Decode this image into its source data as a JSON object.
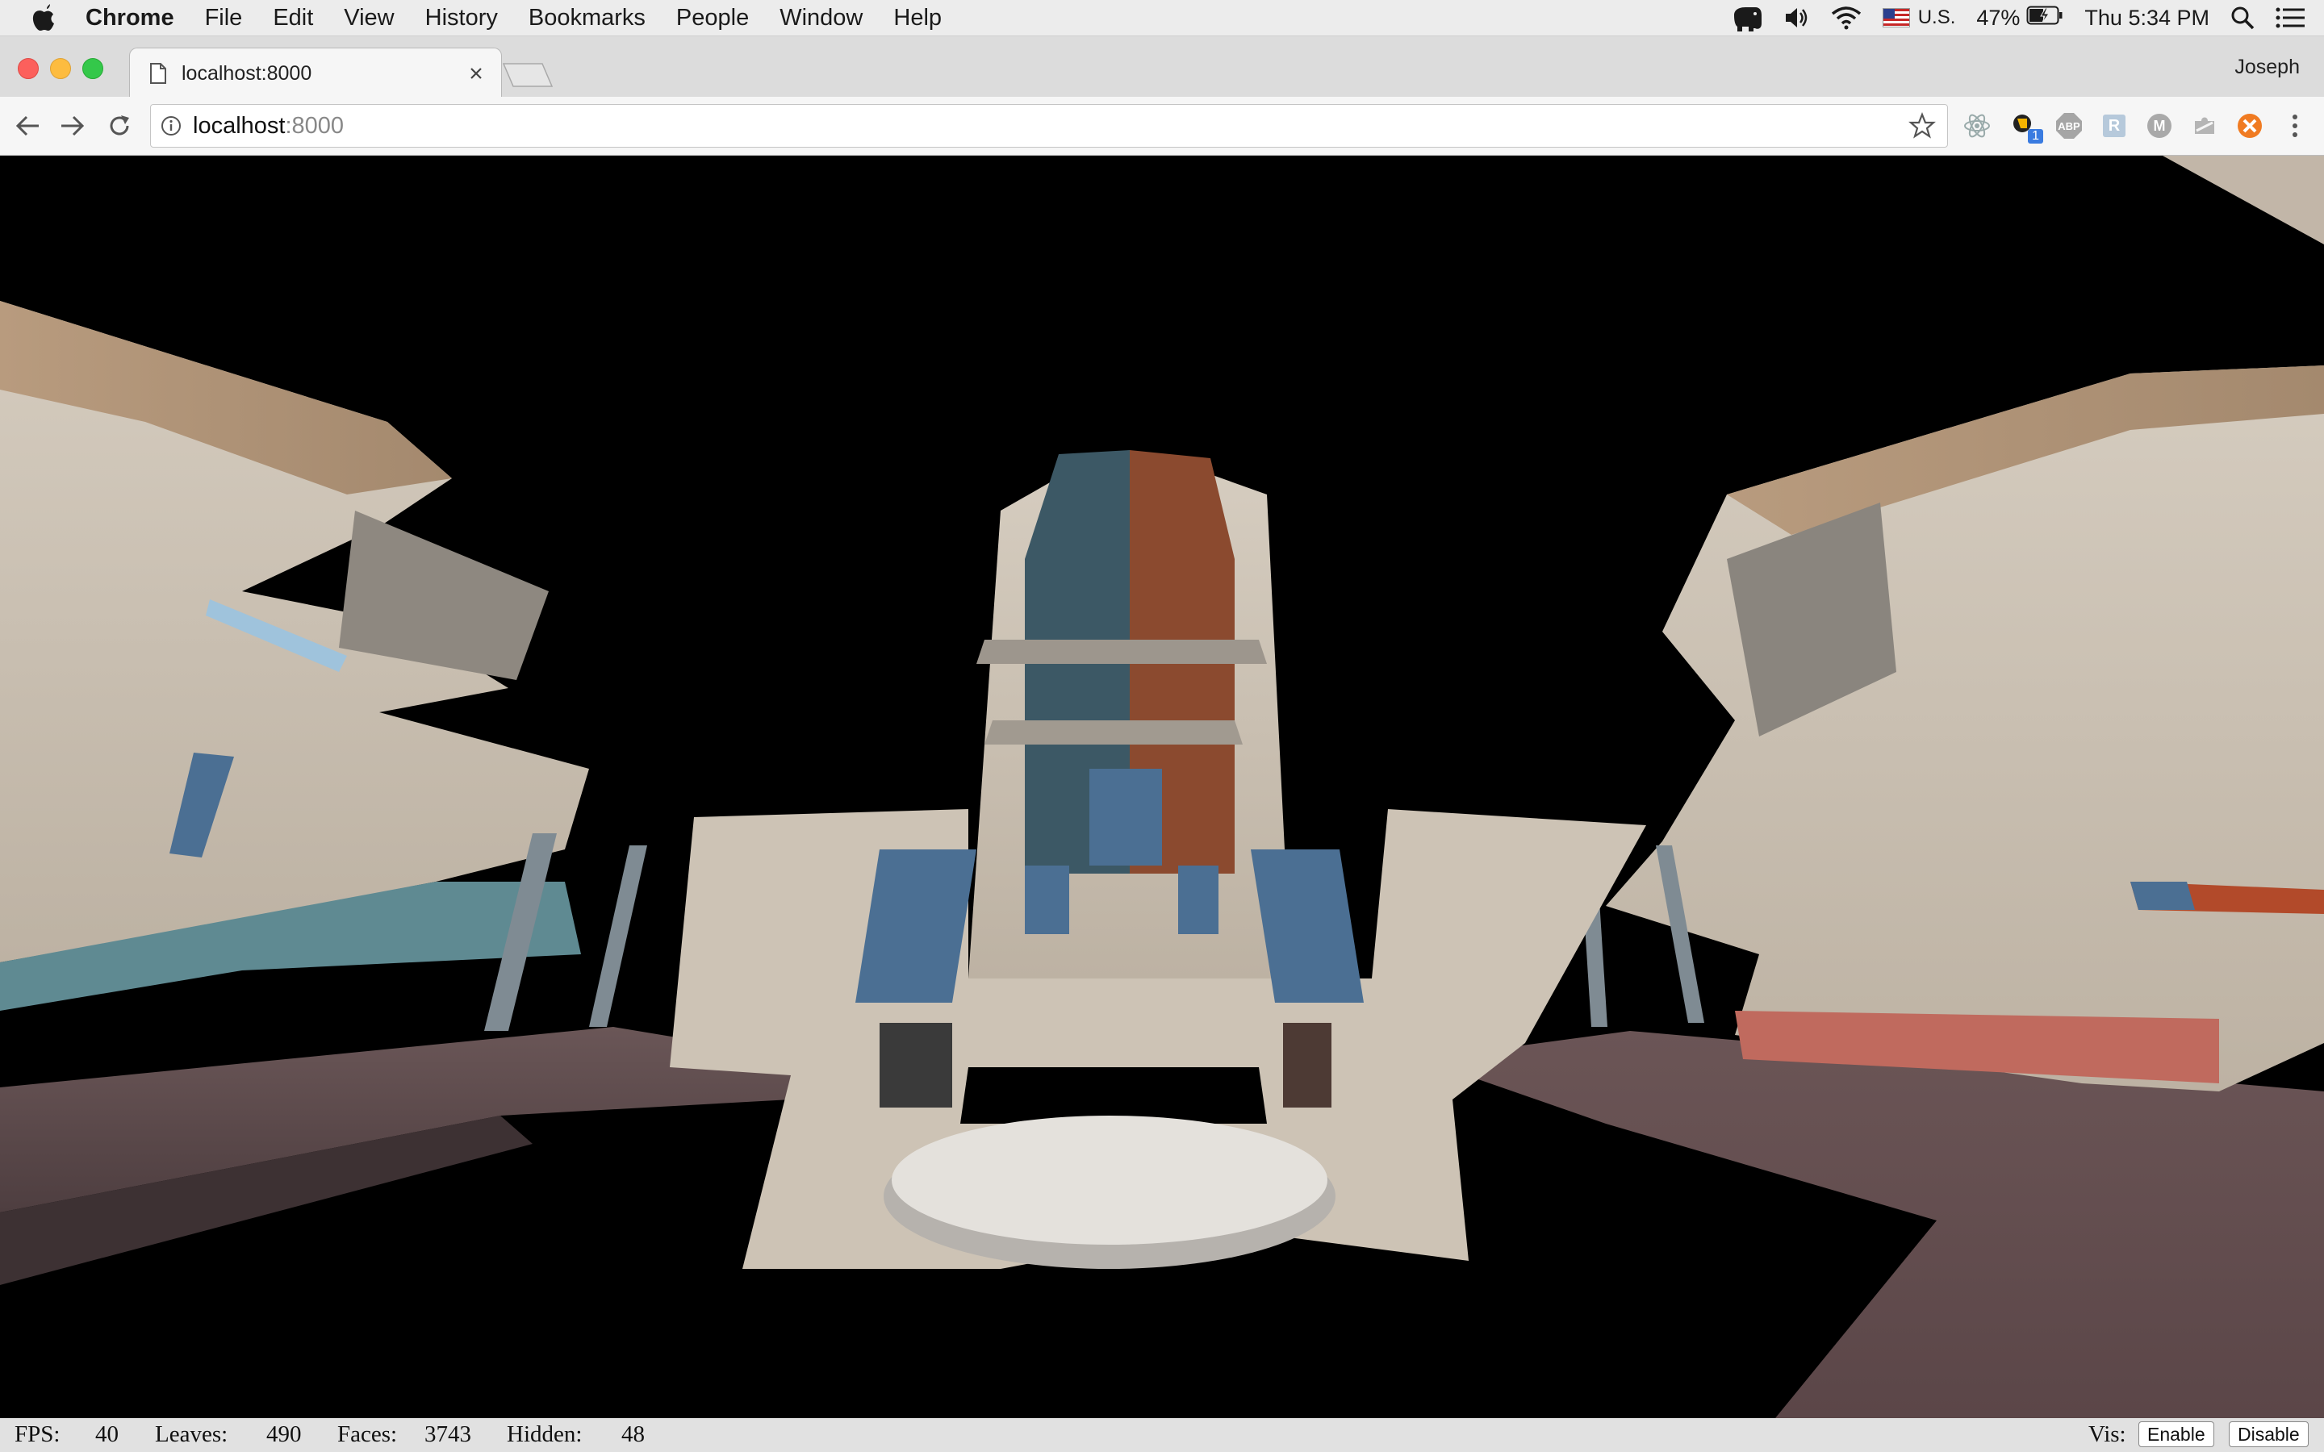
{
  "menubar": {
    "app_name": "Chrome",
    "items": [
      "File",
      "Edit",
      "View",
      "History",
      "Bookmarks",
      "People",
      "Window",
      "Help"
    ],
    "input_source": "U.S.",
    "battery": "47%",
    "clock": "Thu 5:34 PM"
  },
  "browser": {
    "tab_title": "localhost:8000",
    "profile_name": "Joseph",
    "url_host": "localhost",
    "url_port": ":8000",
    "extension_badge": "1",
    "extension_abp": "ABP",
    "extension_r": "R",
    "extension_m": "M"
  },
  "stats": {
    "fps_label": "FPS:",
    "fps_value": "40",
    "leaves_label": "Leaves:",
    "leaves_value": "490",
    "faces_label": "Faces:",
    "faces_value": "3743",
    "hidden_label": "Hidden:",
    "hidden_value": "48",
    "vis_label": "Vis:",
    "enable_label": "Enable",
    "disable_label": "Disable"
  },
  "colors": {
    "concrete": "#cfc4b4",
    "rust": "#8b4a2f",
    "steel_blue": "#3c5865",
    "walkway": "#5e4a4b",
    "window_blue": "#4b6f93"
  },
  "icons": [
    "apple-icon",
    "evernote-icon",
    "volume-icon",
    "wifi-icon",
    "battery-icon",
    "spotlight-icon",
    "notification-center-icon",
    "page-icon",
    "close-icon",
    "back-icon",
    "forward-icon",
    "reload-icon",
    "info-icon",
    "star-icon",
    "menu-icon"
  ]
}
